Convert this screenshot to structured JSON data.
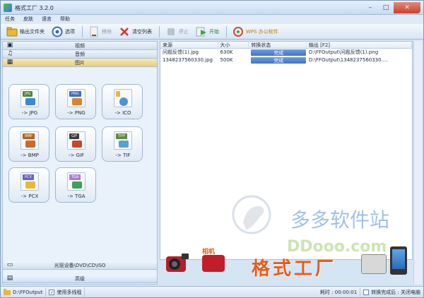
{
  "window": {
    "title": "格式工厂 3.2.0",
    "min": "–",
    "max": "□",
    "close": "✕"
  },
  "menu": [
    "任务",
    "皮肤",
    "语言",
    "帮助"
  ],
  "toolbar": {
    "output_folder": "输出文件夹",
    "options": "选项",
    "remove": "移除",
    "clear_list": "清空列表",
    "stop": "停止",
    "start": "开始",
    "wps": "WPS 办公软件"
  },
  "categories": {
    "video": "视频",
    "audio": "音频",
    "image": "图片",
    "rom": "光驱设备\\DVD\\CD\\ISO",
    "advanced": "高级"
  },
  "tiles": [
    {
      "tag": "JPG",
      "label": "-> JPG",
      "tag_color": "#4b8a3b",
      "art_color": "#3f86d6"
    },
    {
      "tag": "PNG",
      "label": "-> PNG",
      "tag_color": "#3a6fbf",
      "art_color": "#d9852b"
    },
    {
      "tag": "",
      "label": "-> ICO",
      "tag_color": "#e6b93a",
      "art_color": "#4b93d9"
    },
    {
      "tag": "BMP",
      "label": "-> BMP",
      "tag_color": "#b2631d",
      "art_color": "#c96a2e"
    },
    {
      "tag": "GIF",
      "label": "-> GIF",
      "tag_color": "#3a3a3a",
      "art_color": "#c9452b"
    },
    {
      "tag": "TIFF",
      "label": "-> TIF",
      "tag_color": "#5c8c3b",
      "art_color": "#5aa0d8"
    },
    {
      "tag": "PCX",
      "label": "-> PCX",
      "tag_color": "#6b5fc2",
      "art_color": "#e7b93a"
    },
    {
      "tag": "TGA",
      "label": "-> TGA",
      "tag_color": "#b07ad6",
      "art_color": "#3ea05a"
    }
  ],
  "table": {
    "headers": [
      "来源",
      "大小",
      "转换状态",
      "输出 [F2]"
    ],
    "rows": [
      {
        "source": "问题反馈(1).jpg",
        "size": "630K",
        "status": "完成",
        "output": "D:\\FFOutput\\问题反馈(1).png"
      },
      {
        "source": "1348237560330.jpg",
        "size": "500K",
        "status": "完成",
        "output": "D:\\FFOutput\\1348237560330...."
      }
    ]
  },
  "watermark": {
    "site": "多多软件站",
    "url": "DDooo.com"
  },
  "banner": {
    "main": "格式工厂",
    "camera_label": "相机"
  },
  "statusbar": {
    "folder": "D:\\FFOutput",
    "multithread": "使用多线程",
    "elapsed": "耗时 : 00:00:01",
    "after_convert": "转换完成后 : 关闭电脑"
  },
  "colors": {
    "accent": "#3e74c6",
    "banner": "#e85b1a"
  }
}
